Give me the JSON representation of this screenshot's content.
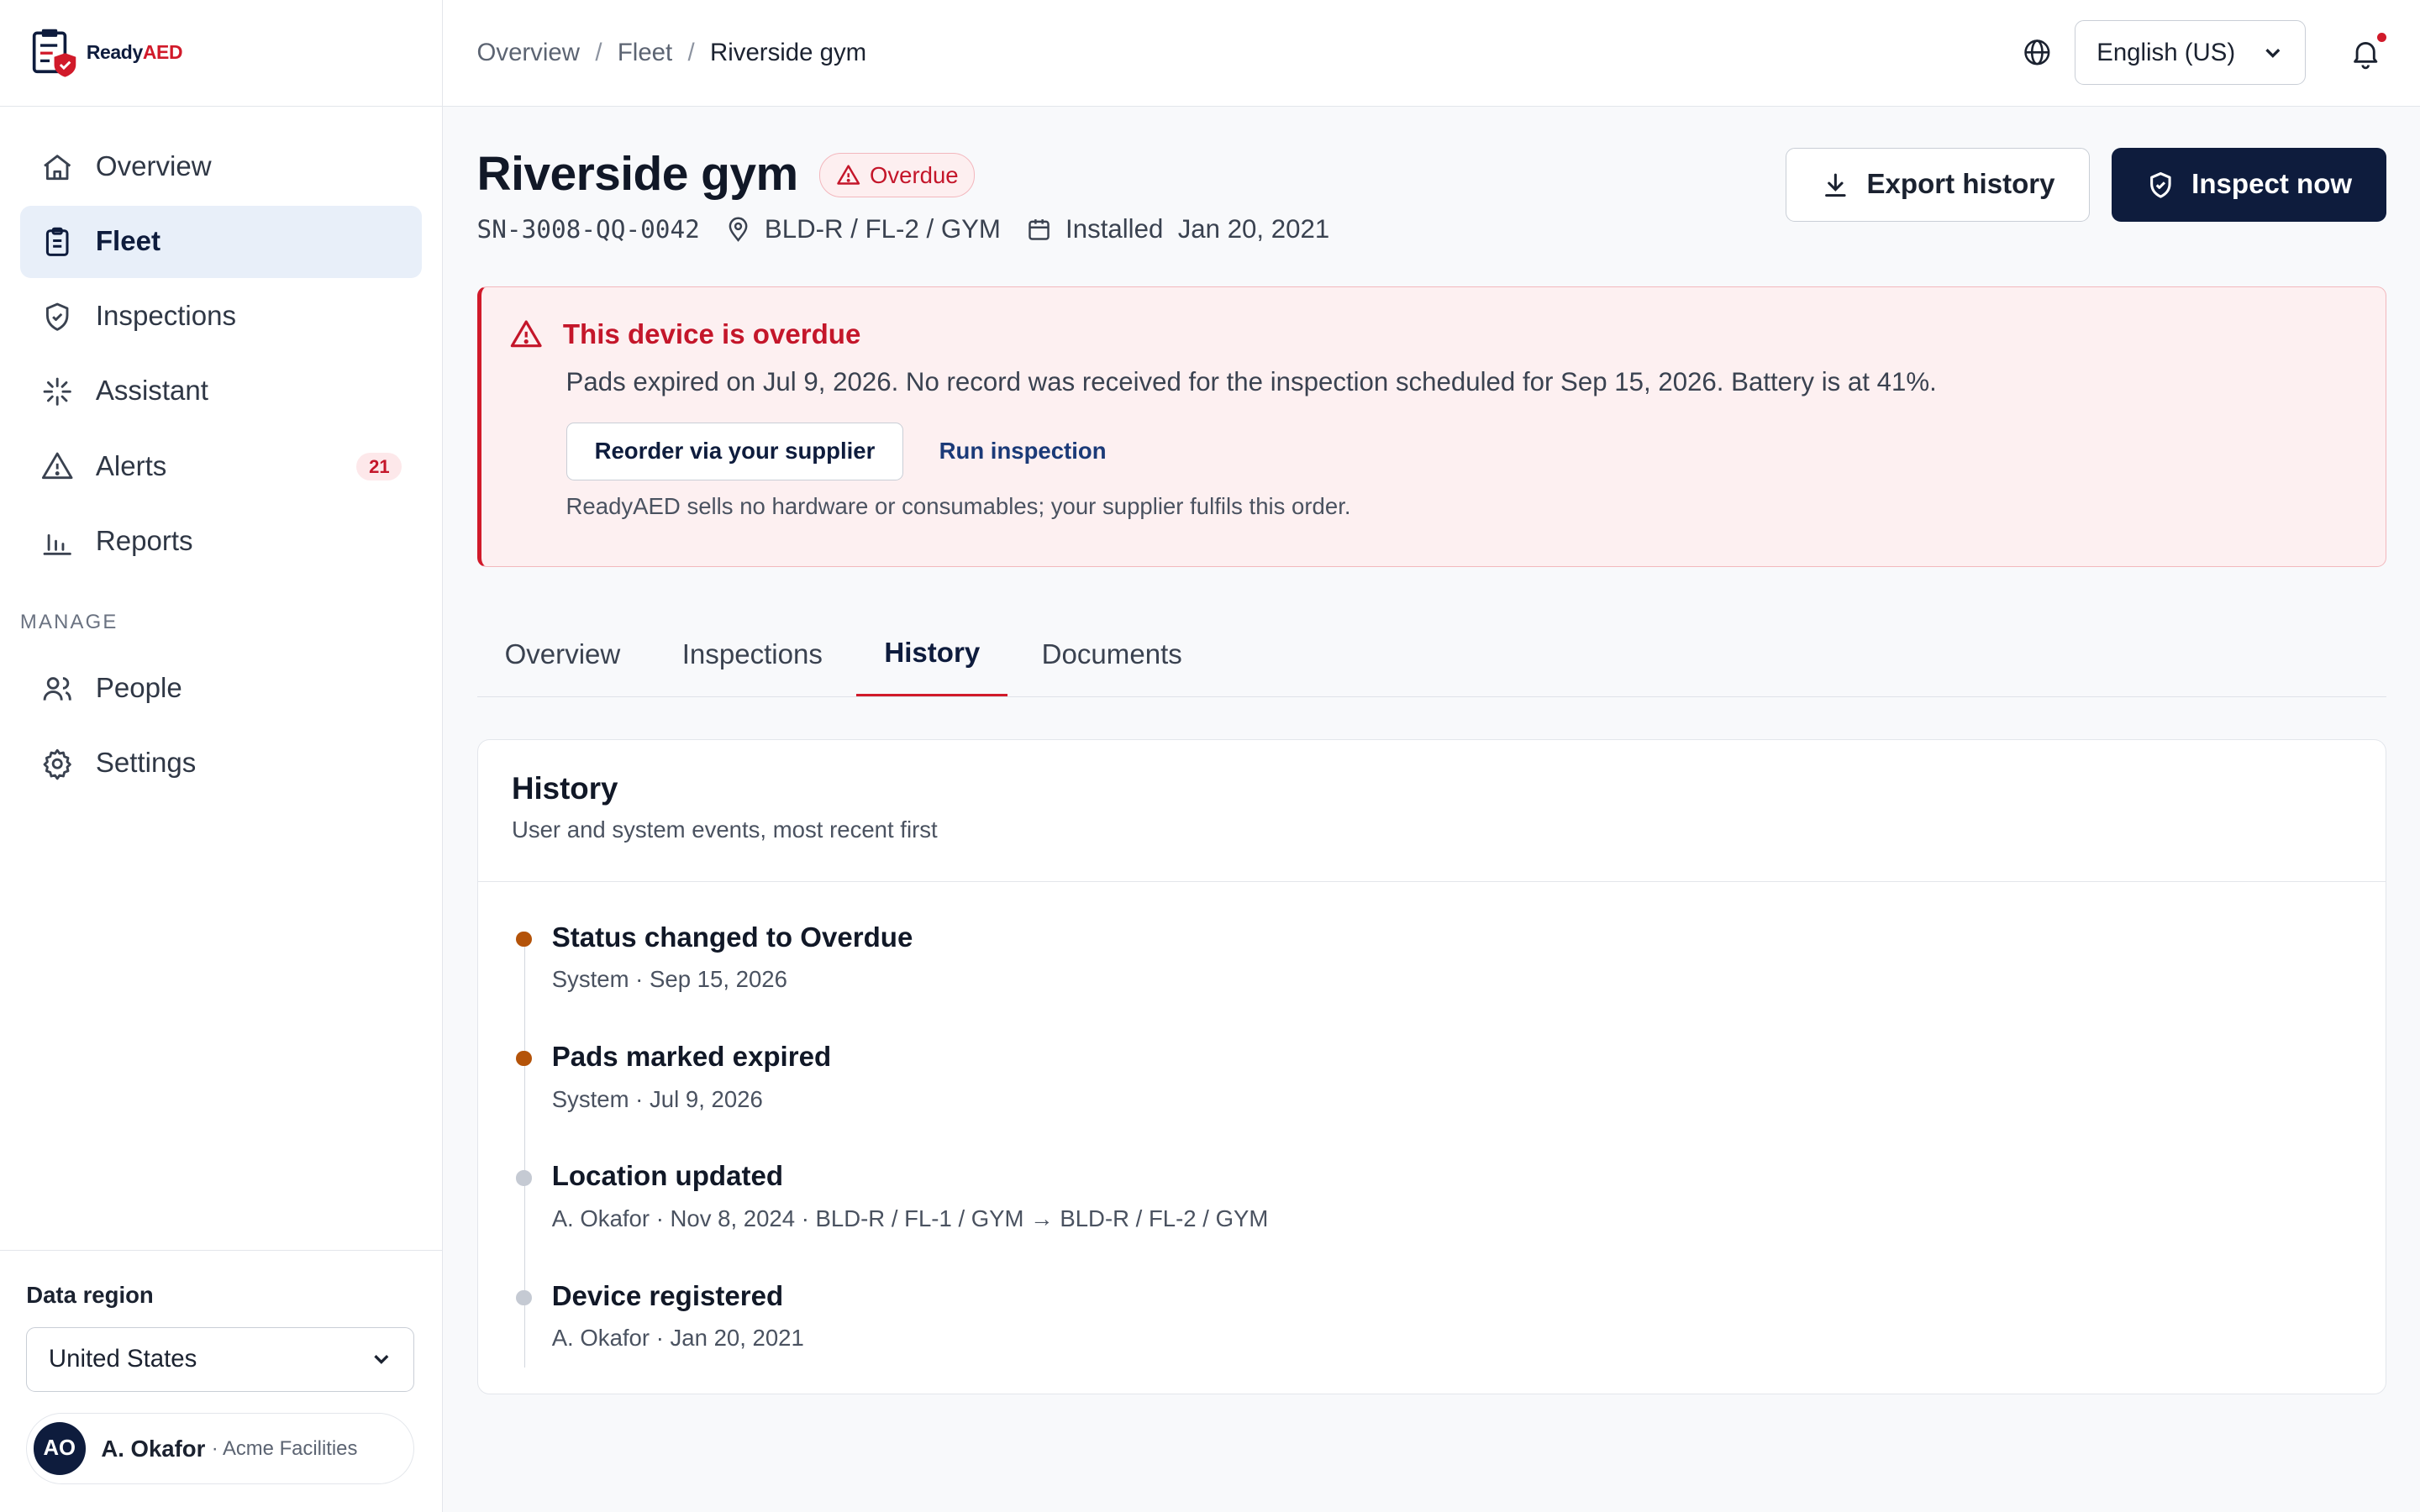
{
  "brand": {
    "name_part1": "Ready",
    "name_part2": "AED"
  },
  "sidebar": {
    "nav": [
      {
        "label": "Overview",
        "icon": "home-icon",
        "active": false
      },
      {
        "label": "Fleet",
        "icon": "clipboard-icon",
        "active": true
      },
      {
        "label": "Inspections",
        "icon": "shield-check-icon",
        "active": false
      },
      {
        "label": "Assistant",
        "icon": "sparkle-icon",
        "active": false
      },
      {
        "label": "Alerts",
        "icon": "alert-triangle-icon",
        "active": false,
        "badge": "21"
      },
      {
        "label": "Reports",
        "icon": "bar-chart-icon",
        "active": false
      }
    ],
    "manage_label": "MANAGE",
    "manage": [
      {
        "label": "People",
        "icon": "users-icon"
      },
      {
        "label": "Settings",
        "icon": "gear-icon"
      }
    ],
    "data_region_label": "Data region",
    "data_region_value": "United States",
    "user": {
      "initials": "AO",
      "name": "A. Okafor",
      "org": "· Acme Facilities"
    }
  },
  "topbar": {
    "breadcrumb": [
      "Overview",
      "Fleet",
      "Riverside gym"
    ],
    "language": "English (US)"
  },
  "device": {
    "title": "Riverside gym",
    "status": "Overdue",
    "serial": "SN-3008-QQ-0042",
    "location": "BLD-R / FL-2 / GYM",
    "installed_label": "Installed",
    "installed_date": "Jan 20, 2021"
  },
  "actions": {
    "export": "Export history",
    "inspect": "Inspect now"
  },
  "alert": {
    "title": "This device is overdue",
    "body": "Pads expired on Jul 9, 2026. No record was received for the inspection scheduled for Sep 15, 2026. Battery is at 41%.",
    "reorder": "Reorder via your supplier",
    "run": "Run inspection",
    "note": "ReadyAED sells no hardware or consumables; your supplier fulfils this order."
  },
  "tabs": [
    {
      "label": "Overview",
      "active": false
    },
    {
      "label": "Inspections",
      "active": false
    },
    {
      "label": "History",
      "active": true
    },
    {
      "label": "Documents",
      "active": false
    }
  ],
  "history": {
    "title": "History",
    "subtitle": "User and system events, most recent first",
    "events": [
      {
        "title": "Status changed to Overdue",
        "meta": "System · Sep 15, 2026",
        "dot_color": "#b45309"
      },
      {
        "title": "Pads marked expired",
        "meta": "System · Jul 9, 2026",
        "dot_color": "#b45309"
      },
      {
        "title": "Location updated",
        "meta": "A. Okafor · Nov 8, 2024 · BLD-R / FL-1 / GYM → BLD-R / FL-2 / GYM",
        "dot_color": "#c5cad3"
      },
      {
        "title": "Device registered",
        "meta": "A. Okafor · Jan 20, 2021",
        "dot_color": "#c5cad3"
      }
    ]
  },
  "colors": {
    "navy": "#0e1c3d",
    "danger": "#d11a2a",
    "active_bg": "#e8eff9"
  }
}
